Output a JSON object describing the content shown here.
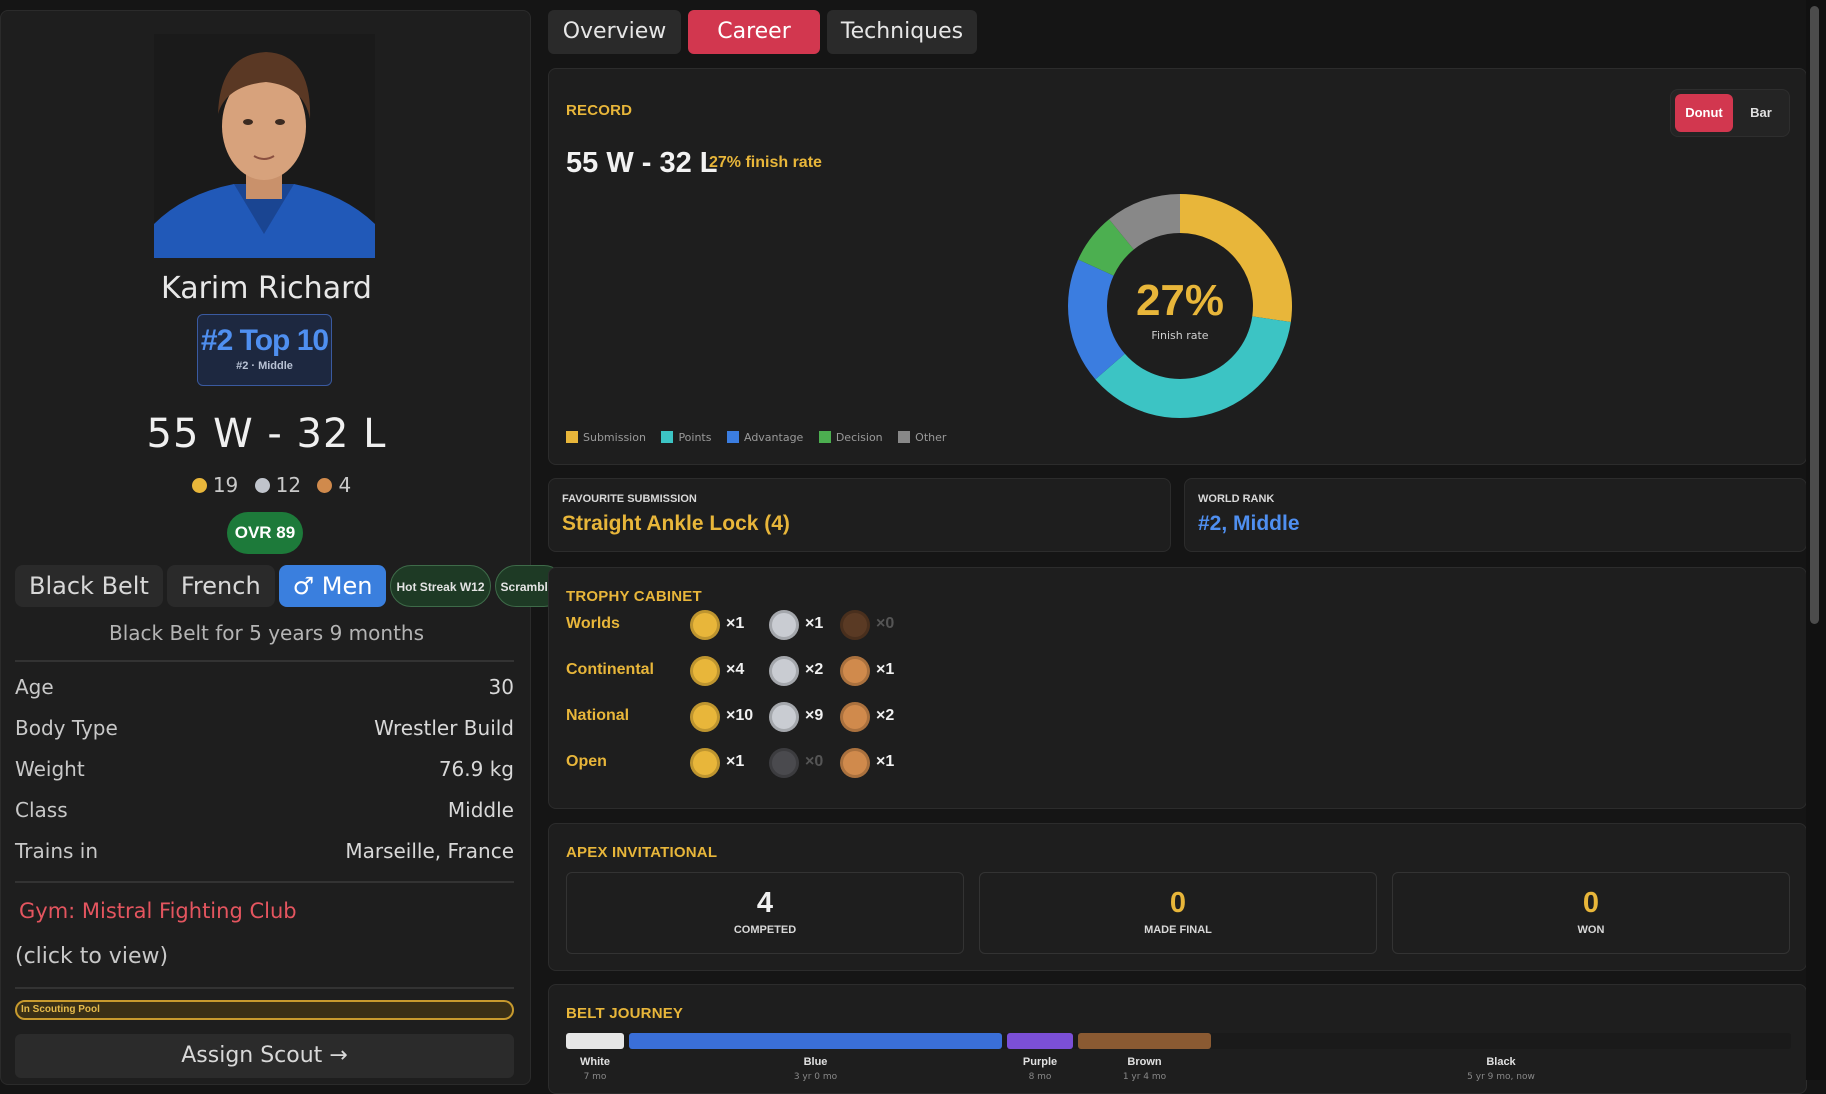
{
  "profile": {
    "name": "Karim Richard",
    "rank_title": "#2 Top 10",
    "rank_sub": "#2 · Middle",
    "record": "55 W - 32 L",
    "medals": {
      "gold": "19",
      "silver": "12",
      "bronze": "4"
    },
    "ovr": "OVR 89",
    "chips": {
      "belt": "Black Belt",
      "nationality": "French",
      "division": "♂ Men",
      "tag1": "Hot Streak W12",
      "tag2": "Scrambler"
    },
    "belt_years": "Black Belt for 5 years 9 months",
    "info": [
      {
        "label": "Age",
        "value": "30"
      },
      {
        "label": "Body Type",
        "value": "Wrestler Build"
      },
      {
        "label": "Weight",
        "value": "76.9 kg"
      },
      {
        "label": "Class",
        "value": "Middle"
      },
      {
        "label": "Trains in",
        "value": "Marseille, France"
      }
    ],
    "gym": "Gym: Mistral Fighting Club",
    "gym_hint": "(click to view)",
    "scouting": "In Scouting Pool",
    "assign": "Assign Scout →"
  },
  "tabs": [
    {
      "label": "Overview",
      "active": false
    },
    {
      "label": "Career",
      "active": true
    },
    {
      "label": "Techniques",
      "active": false
    }
  ],
  "record_panel": {
    "title": "RECORD",
    "record": "55 W - 32 L",
    "finish_rate_text": "27% finish rate",
    "toggle": {
      "donut": "Donut",
      "bar": "Bar",
      "active": "Donut"
    },
    "center_value": "27%",
    "center_label": "Finish rate"
  },
  "chart_data": {
    "type": "pie",
    "variant": "donut",
    "categories": [
      "Submission",
      "Points",
      "Advantage",
      "Decision",
      "Other"
    ],
    "values": [
      15,
      20,
      10,
      4,
      6
    ],
    "colors": [
      "#e8b63a",
      "#3cc4c4",
      "#3b7de0",
      "#4caf50",
      "#888888"
    ],
    "center_value": "27%",
    "center_label": "Finish rate",
    "legend": "bottom-left"
  },
  "fav_submission": {
    "label": "FAVOURITE SUBMISSION",
    "value": "Straight Ankle Lock (4)"
  },
  "world_rank": {
    "label": "WORLD RANK",
    "value": "#2, Middle"
  },
  "trophy": {
    "title": "TROPHY CABINET",
    "rows": [
      {
        "label": "Worlds",
        "gold": "×1",
        "silver": "×1",
        "bronze": "×0"
      },
      {
        "label": "Continental",
        "gold": "×4",
        "silver": "×2",
        "bronze": "×1"
      },
      {
        "label": "National",
        "gold": "×10",
        "silver": "×9",
        "bronze": "×2"
      },
      {
        "label": "Open",
        "gold": "×1",
        "silver": "×0",
        "bronze": "×1"
      }
    ]
  },
  "apex": {
    "title": "APEX INVITATIONAL",
    "stats": [
      {
        "value": "4",
        "label": "COMPETED"
      },
      {
        "value": "0",
        "label": "MADE FINAL"
      },
      {
        "value": "0",
        "label": "WON"
      }
    ]
  },
  "belt_journey": {
    "title": "BELT JOURNEY",
    "belts": [
      {
        "name": "White",
        "duration": "7 mo",
        "color": "#e6e6e6"
      },
      {
        "name": "Blue",
        "duration": "3 yr 0 mo",
        "color": "#3a6fd8"
      },
      {
        "name": "Purple",
        "duration": "8 mo",
        "color": "#7b4fd6"
      },
      {
        "name": "Brown",
        "duration": "1 yr 4 mo",
        "color": "#8a5a32"
      },
      {
        "name": "Black",
        "duration": "5 yr 9 mo, now",
        "color": "#1a1a1a"
      }
    ]
  }
}
